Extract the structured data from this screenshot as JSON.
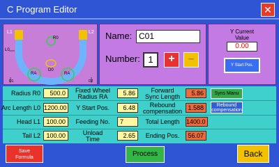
{
  "window": {
    "title": "C Program Editor",
    "close_label": "✕"
  },
  "diagram": {
    "labels": {
      "l1": "L1",
      "l2": "L2",
      "l0": "L0",
      "r0": "R0",
      "ra_left": "RA",
      "ra_right": "RA",
      "d0": "D0",
      "d1": "D1",
      "d2": "D2"
    }
  },
  "program": {
    "name_label": "Name:",
    "name_value": "C01",
    "number_label": "Number:",
    "number_value": "1",
    "plus_label": "+",
    "minus_label": "–"
  },
  "y_panel": {
    "title_line1": "Y Current",
    "title_line2": "Value",
    "current_value": "0.00",
    "start_pos_button": "Y Start Pos."
  },
  "params": {
    "radius_r0": {
      "label": "Radius R0",
      "value": "500.0"
    },
    "arc_length_l0": {
      "label": "Arc Length L0",
      "value": "1200.00"
    },
    "head_l1": {
      "label": "Head L1",
      "value": "100.00"
    },
    "tail_l2": {
      "label": "Tail L2",
      "value": "100.00"
    },
    "fixed_wheel_radius": {
      "label_line1": "Fixed Wheel",
      "label_line2": "Radius RA",
      "value": "5.86"
    },
    "y_start_pos": {
      "label": "Y Start Pos.",
      "value": "6.48"
    },
    "feeding_no": {
      "label": "Feeding No.",
      "value": "7"
    },
    "unload_time": {
      "label_line1": "Unload",
      "label_line2": "Time",
      "value": "2.65"
    },
    "forward_sync_length": {
      "label_line1": "Forward",
      "label_line2": "Sync Length",
      "value": "5.86"
    },
    "rebound_compensation": {
      "label_line1": "Rebound",
      "label_line2": "compensation",
      "value": "1.588"
    },
    "total_length": {
      "label": "Total Length",
      "value": "1400.0"
    },
    "ending_pos": {
      "label": "Ending Pos.",
      "value": "56.07"
    }
  },
  "side_buttons": {
    "syns_manu": "Syns Manu",
    "rebound_comp_line1": "Rebound",
    "rebound_comp_line2": "compensation"
  },
  "bottom": {
    "save_line1": "Save",
    "save_line2": "Formula",
    "process": "Process",
    "back": "Back"
  },
  "colors": {
    "title_bar": "#2f55d4",
    "panel": "#c47ae3",
    "grid": "#3fd0cc",
    "value_yellow": "#fff8a0",
    "value_orange": "#ef6a3a",
    "accent_red": "#e63232",
    "accent_green": "#33a848"
  }
}
